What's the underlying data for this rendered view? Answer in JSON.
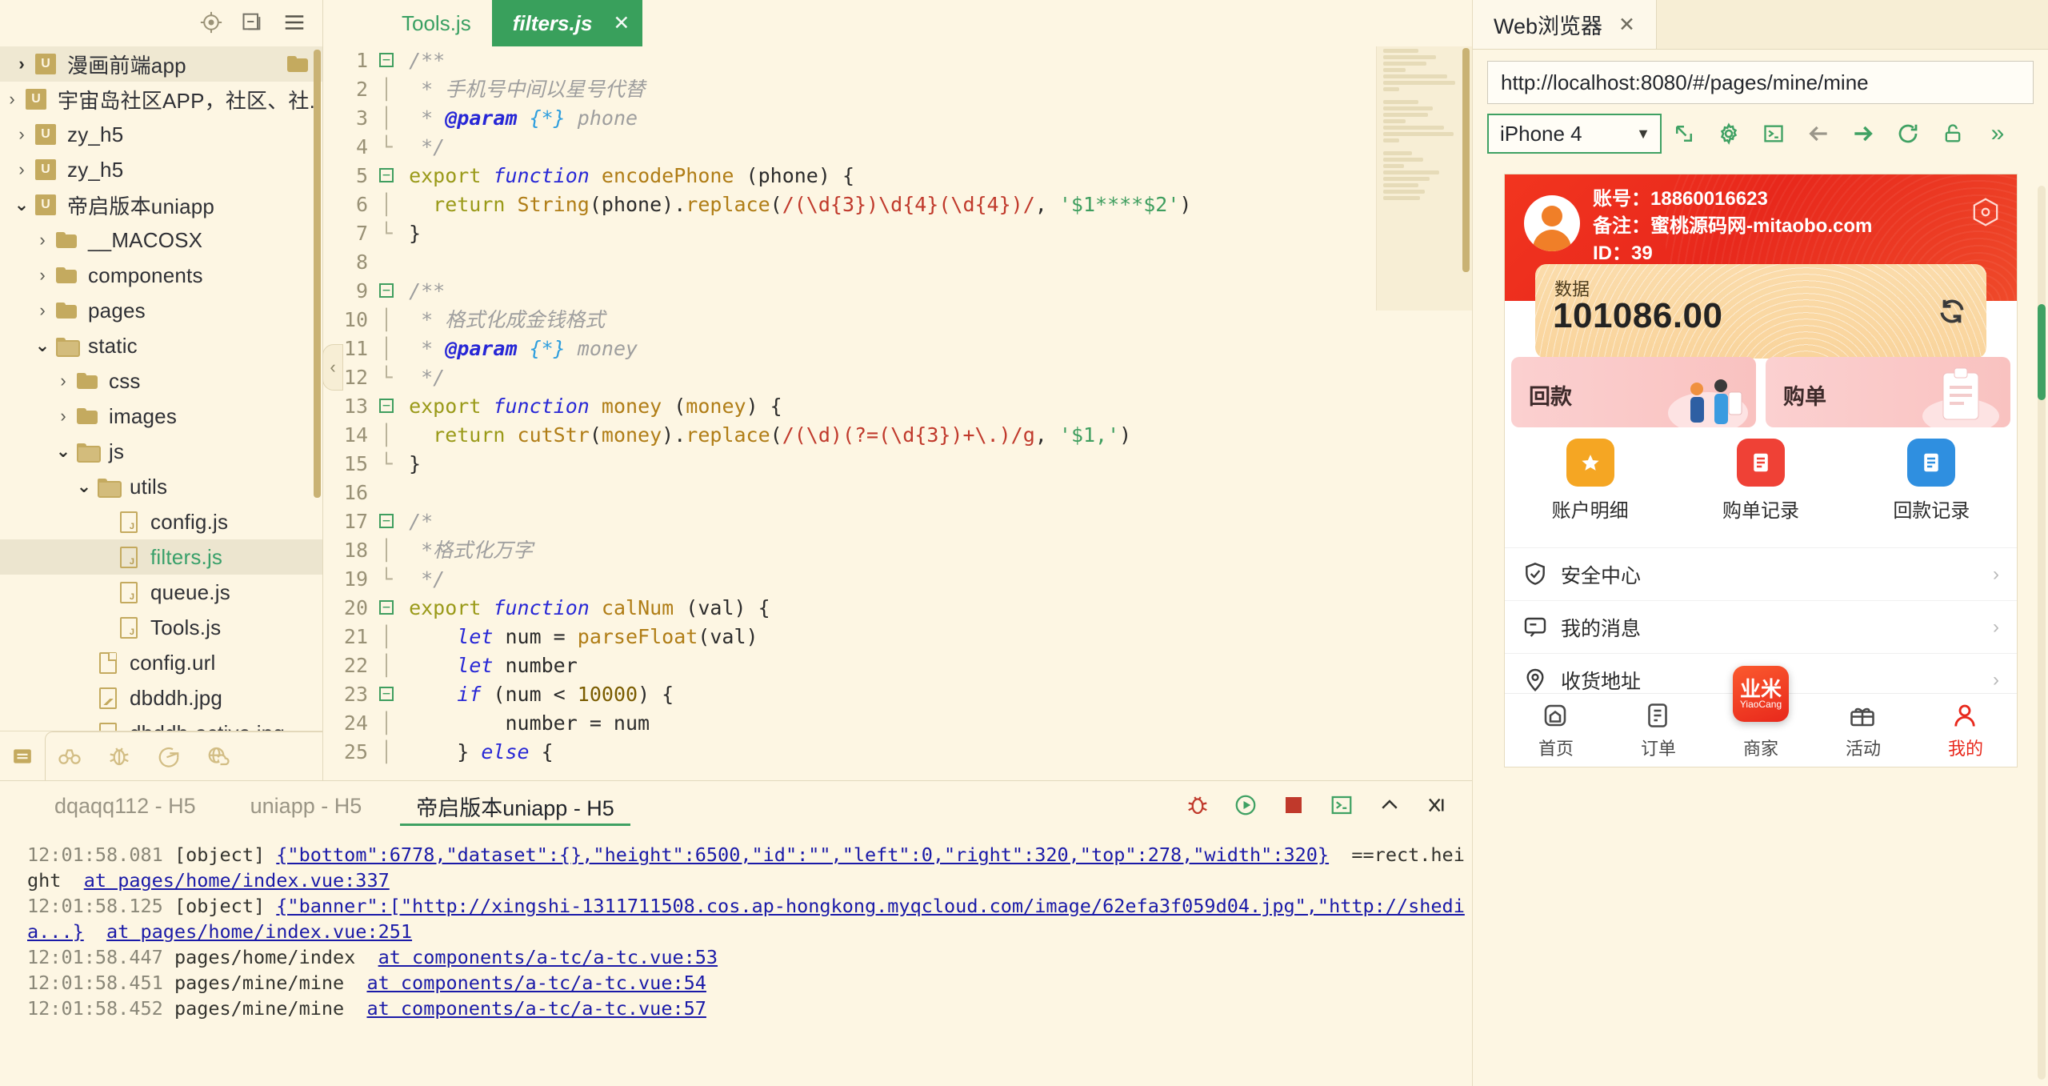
{
  "sidebar": {
    "header_icons": [
      "locate-icon",
      "collapse-all-icon",
      "menu-icon"
    ],
    "tree": [
      {
        "label": "漫画前端app",
        "icon": "uniapp-project-icon",
        "depth": 0,
        "twist": "chevron-right",
        "selected_soft": true,
        "tail_icon": "folder-icon"
      },
      {
        "label": "宇宙岛社区APP，社区、社...",
        "icon": "uniapp-project-icon",
        "depth": 0,
        "twist": "chevron-right"
      },
      {
        "label": "zy_h5",
        "icon": "uniapp-project-icon",
        "depth": 0,
        "twist": "chevron-right"
      },
      {
        "label": "zy_h5",
        "icon": "uniapp-project-icon",
        "depth": 0,
        "twist": "chevron-right"
      },
      {
        "label": "帝启版本uniapp",
        "icon": "uniapp-project-icon",
        "depth": 0,
        "twist": "chevron-down"
      },
      {
        "label": "__MACOSX",
        "icon": "folder-closed-icon",
        "depth": 1,
        "twist": "chevron-right"
      },
      {
        "label": "components",
        "icon": "folder-closed-icon",
        "depth": 1,
        "twist": "chevron-right"
      },
      {
        "label": "pages",
        "icon": "folder-closed-icon",
        "depth": 1,
        "twist": "chevron-right"
      },
      {
        "label": "static",
        "icon": "folder-open-icon",
        "depth": 1,
        "twist": "chevron-down"
      },
      {
        "label": "css",
        "icon": "folder-closed-icon",
        "depth": 2,
        "twist": "chevron-right"
      },
      {
        "label": "images",
        "icon": "folder-closed-icon",
        "depth": 2,
        "twist": "chevron-right"
      },
      {
        "label": "js",
        "icon": "folder-open-icon",
        "depth": 2,
        "twist": "chevron-down"
      },
      {
        "label": "utils",
        "icon": "folder-open-icon",
        "depth": 3,
        "twist": "chevron-down"
      },
      {
        "label": "config.js",
        "icon": "js-file-icon",
        "depth": 4,
        "twist": "none"
      },
      {
        "label": "filters.js",
        "icon": "js-file-icon",
        "depth": 4,
        "twist": "none",
        "selected": true,
        "green": true
      },
      {
        "label": "queue.js",
        "icon": "js-file-icon",
        "depth": 4,
        "twist": "none"
      },
      {
        "label": "Tools.js",
        "icon": "js-file-icon",
        "depth": 4,
        "twist": "none"
      },
      {
        "label": "config.url",
        "icon": "plain-file-icon",
        "depth": 3,
        "twist": "none"
      },
      {
        "label": "dbddh.jpg",
        "icon": "image-file-icon",
        "depth": 3,
        "twist": "none"
      },
      {
        "label": "dbddh-active.jpg",
        "icon": "image-file-icon",
        "depth": 3,
        "twist": "none"
      }
    ],
    "footer_icons": [
      "project-explorer-icon",
      "binoculars-icon",
      "bug-icon",
      "terminal-share-icon",
      "cloud-globe-icon"
    ]
  },
  "editor": {
    "tabs": [
      {
        "label": "Tools.js",
        "active": false,
        "closable": false
      },
      {
        "label": "filters.js",
        "active": true,
        "closable": true,
        "close_label": "✕"
      }
    ],
    "lines": [
      {
        "n": "1",
        "fold": "box"
      },
      {
        "n": "2",
        "fold": "bar"
      },
      {
        "n": "3",
        "fold": "bar"
      },
      {
        "n": "4",
        "fold": "end"
      },
      {
        "n": "5",
        "fold": "box"
      },
      {
        "n": "6",
        "fold": "bar"
      },
      {
        "n": "7",
        "fold": "end"
      },
      {
        "n": "8",
        "fold": "none"
      },
      {
        "n": "9",
        "fold": "box"
      },
      {
        "n": "10",
        "fold": "bar"
      },
      {
        "n": "11",
        "fold": "bar"
      },
      {
        "n": "12",
        "fold": "end"
      },
      {
        "n": "13",
        "fold": "box"
      },
      {
        "n": "14",
        "fold": "bar"
      },
      {
        "n": "15",
        "fold": "end"
      },
      {
        "n": "16",
        "fold": "none"
      },
      {
        "n": "17",
        "fold": "box"
      },
      {
        "n": "18",
        "fold": "bar"
      },
      {
        "n": "19",
        "fold": "end"
      },
      {
        "n": "20",
        "fold": "box"
      },
      {
        "n": "21",
        "fold": "bar"
      },
      {
        "n": "22",
        "fold": "bar"
      },
      {
        "n": "23",
        "fold": "box"
      },
      {
        "n": "24",
        "fold": "bar"
      },
      {
        "n": "25",
        "fold": "bar"
      }
    ],
    "source_text": [
      "/**",
      " * 手机号中间以星号代替",
      " * @param {*} phone",
      " */",
      "export function encodePhone (phone) {",
      "  return String(phone).replace(/(\\d{3})\\d{4}(\\d{4})/, '$1****$2')",
      "}",
      "",
      "/**",
      " * 格式化成金钱格式",
      " * @param {*} money",
      " */",
      "export function money (money) {",
      "  return cutStr(money).replace(/(\\d)(?=(\\d{3})+\\.)/g, '$1,')",
      "}",
      "",
      "/*",
      " *格式化万字",
      " */",
      "export function calNum (val) {",
      "    let num = parseFloat(val)",
      "    let number",
      "    if (num < 10000) {",
      "        number = num",
      "    } else {"
    ]
  },
  "console": {
    "tabs": [
      {
        "label": "dqaqq112 - H5",
        "active": false
      },
      {
        "label": "uniapp - H5",
        "active": false
      },
      {
        "label": "帝启版本uniapp - H5",
        "active": true
      }
    ],
    "tools": [
      "debug-icon",
      "run-icon",
      "stop-icon",
      "new-terminal-icon",
      "collapse-icon",
      "clear-icon"
    ],
    "entries": [
      {
        "time": "12:01:58.081",
        "tag": "[object]",
        "link": "{\"bottom\":6778,\"dataset\":{},\"height\":6500,\"id\":\"\",\"left\":0,\"right\":320,\"top\":278,\"width\":320}",
        "suffix": "==rect.height",
        "source": "at pages/home/index.vue:337"
      },
      {
        "time": "12:01:58.125",
        "tag": "[object]",
        "link": "{\"banner\":[\"http://xingshi-1311711508.cos.ap-hongkong.myqcloud.com/image/62efa3f059d04.jpg\",\"http://shedia...}",
        "suffix": "",
        "source": "at pages/home/index.vue:251"
      },
      {
        "time": "12:01:58.447",
        "tag": "",
        "link": "",
        "plain": "pages/home/index",
        "source": "at components/a-tc/a-tc.vue:53"
      },
      {
        "time": "12:01:58.451",
        "tag": "",
        "link": "",
        "plain": "pages/mine/mine",
        "source": "at components/a-tc/a-tc.vue:54"
      },
      {
        "time": "12:01:58.452",
        "tag": "",
        "link": "",
        "plain": "pages/mine/mine",
        "source": "at components/a-tc/a-tc.vue:57"
      }
    ]
  },
  "browser": {
    "tab_label": "Web浏览器",
    "tab_close": "✕",
    "url": "http://localhost:8080/#/pages/mine/mine",
    "device": "iPhone 4",
    "toolbar_icons": [
      "open-external-icon",
      "settings-gear-icon",
      "console-icon",
      "back-arrow-icon",
      "forward-arrow-icon",
      "reload-icon",
      "unlock-icon",
      "more-chevrons-icon"
    ],
    "overflow_label": "»"
  },
  "preview": {
    "account_label": "账号：",
    "account_value": "18860016623",
    "remark_label": "备注：",
    "remark_value": "蜜桃源码网-mitaobo.com",
    "id_label": "ID：",
    "id_value": "39",
    "data_label": "数据",
    "data_value": "101086.00",
    "refresh_icon": "refresh-icon",
    "scan_icon": "scan-hex-icon",
    "cards": [
      {
        "title": "回款",
        "art": "people-illustration"
      },
      {
        "title": "购单",
        "art": "clipboard-illustration"
      }
    ],
    "quick": [
      {
        "label": "账户明细",
        "icon": "star-square-icon",
        "color": "#f5a623"
      },
      {
        "label": "购单记录",
        "icon": "doc-red-icon",
        "color": "#ef4136"
      },
      {
        "label": "回款记录",
        "icon": "doc-blue-icon",
        "color": "#2f8fe0"
      }
    ],
    "list": [
      {
        "label": "安全中心",
        "icon": "shield-check-icon",
        "chevron": "›"
      },
      {
        "label": "我的消息",
        "icon": "message-icon",
        "chevron": "›"
      },
      {
        "label": "收货地址",
        "icon": "location-pin-icon",
        "chevron": "›"
      }
    ],
    "tabbar": [
      {
        "label": "首页",
        "icon": "home-icon",
        "active": false
      },
      {
        "label": "订单",
        "icon": "order-icon",
        "active": false
      },
      {
        "label": "商家",
        "icon": "merchant-fab-icon",
        "active": false,
        "fab": true,
        "fab_big": "业米",
        "fab_small": "YiaoCang"
      },
      {
        "label": "活动",
        "icon": "gift-icon",
        "active": false
      },
      {
        "label": "我的",
        "icon": "user-icon",
        "active": true
      }
    ]
  }
}
